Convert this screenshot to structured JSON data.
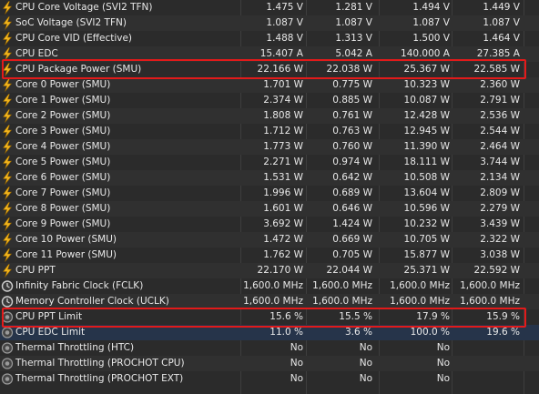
{
  "colors": {
    "background": "#2b2b2b",
    "text": "#e8e8e8",
    "highlight_box": "#e21a1a",
    "selected_row": "#26344a",
    "bolt_icon": "#f2b51d",
    "clock_icon": "#cfcfcf",
    "throttle_icon": "#9a9a9a"
  },
  "rows": [
    {
      "name": "CPU Core Voltage (SVI2 TFN)",
      "icon": "bolt-icon",
      "v1": "1.475 V",
      "v2": "1.281 V",
      "v3": "1.494 V",
      "v4": "1.449 V"
    },
    {
      "name": "SoC Voltage (SVI2 TFN)",
      "icon": "bolt-icon",
      "v1": "1.087 V",
      "v2": "1.087 V",
      "v3": "1.087 V",
      "v4": "1.087 V"
    },
    {
      "name": "CPU Core VID (Effective)",
      "icon": "bolt-icon",
      "v1": "1.488 V",
      "v2": "1.313 V",
      "v3": "1.500 V",
      "v4": "1.464 V"
    },
    {
      "name": "CPU EDC",
      "icon": "bolt-icon",
      "v1": "15.407 A",
      "v2": "5.042 A",
      "v3": "140.000 A",
      "v4": "27.385 A"
    },
    {
      "name": "CPU Package Power (SMU)",
      "icon": "bolt-icon",
      "v1": "22.166 W",
      "v2": "22.038 W",
      "v3": "25.367 W",
      "v4": "22.585 W"
    },
    {
      "name": "Core 0 Power (SMU)",
      "icon": "bolt-icon",
      "v1": "1.701 W",
      "v2": "0.775 W",
      "v3": "10.323 W",
      "v4": "2.360 W"
    },
    {
      "name": "Core 1 Power (SMU)",
      "icon": "bolt-icon",
      "v1": "2.374 W",
      "v2": "0.885 W",
      "v3": "10.087 W",
      "v4": "2.791 W"
    },
    {
      "name": "Core 2 Power (SMU)",
      "icon": "bolt-icon",
      "v1": "1.808 W",
      "v2": "0.761 W",
      "v3": "12.428 W",
      "v4": "2.536 W"
    },
    {
      "name": "Core 3 Power (SMU)",
      "icon": "bolt-icon",
      "v1": "1.712 W",
      "v2": "0.763 W",
      "v3": "12.945 W",
      "v4": "2.544 W"
    },
    {
      "name": "Core 4 Power (SMU)",
      "icon": "bolt-icon",
      "v1": "1.773 W",
      "v2": "0.760 W",
      "v3": "11.390 W",
      "v4": "2.464 W"
    },
    {
      "name": "Core 5 Power (SMU)",
      "icon": "bolt-icon",
      "v1": "2.271 W",
      "v2": "0.974 W",
      "v3": "18.111 W",
      "v4": "3.744 W"
    },
    {
      "name": "Core 6 Power (SMU)",
      "icon": "bolt-icon",
      "v1": "1.531 W",
      "v2": "0.642 W",
      "v3": "10.508 W",
      "v4": "2.134 W"
    },
    {
      "name": "Core 7 Power (SMU)",
      "icon": "bolt-icon",
      "v1": "1.996 W",
      "v2": "0.689 W",
      "v3": "13.604 W",
      "v4": "2.809 W"
    },
    {
      "name": "Core 8 Power (SMU)",
      "icon": "bolt-icon",
      "v1": "1.601 W",
      "v2": "0.646 W",
      "v3": "10.596 W",
      "v4": "2.279 W"
    },
    {
      "name": "Core 9 Power (SMU)",
      "icon": "bolt-icon",
      "v1": "3.692 W",
      "v2": "1.424 W",
      "v3": "10.232 W",
      "v4": "3.439 W"
    },
    {
      "name": "Core 10 Power (SMU)",
      "icon": "bolt-icon",
      "v1": "1.472 W",
      "v2": "0.669 W",
      "v3": "10.705 W",
      "v4": "2.322 W"
    },
    {
      "name": "Core 11 Power (SMU)",
      "icon": "bolt-icon",
      "v1": "1.762 W",
      "v2": "0.705 W",
      "v3": "15.877 W",
      "v4": "3.038 W"
    },
    {
      "name": "CPU PPT",
      "icon": "bolt-icon",
      "v1": "22.170 W",
      "v2": "22.044 W",
      "v3": "25.371 W",
      "v4": "22.592 W"
    },
    {
      "name": "Infinity Fabric Clock (FCLK)",
      "icon": "clock-icon",
      "v1": "1,600.0 MHz",
      "v2": "1,600.0 MHz",
      "v3": "1,600.0 MHz",
      "v4": "1,600.0 MHz"
    },
    {
      "name": "Memory Controller Clock (UCLK)",
      "icon": "clock-icon",
      "v1": "1,600.0 MHz",
      "v2": "1,600.0 MHz",
      "v3": "1,600.0 MHz",
      "v4": "1,600.0 MHz"
    },
    {
      "name": "CPU PPT Limit",
      "icon": "throttle-icon",
      "v1": "15.6 %",
      "v2": "15.5 %",
      "v3": "17.9 %",
      "v4": "15.9 %"
    },
    {
      "name": "CPU EDC Limit",
      "icon": "throttle-icon",
      "v1": "11.0 %",
      "v2": "3.6 %",
      "v3": "100.0 %",
      "v4": "19.6 %"
    },
    {
      "name": "Thermal Throttling (HTC)",
      "icon": "throttle-icon",
      "v1": "No",
      "v2": "No",
      "v3": "No",
      "v4": ""
    },
    {
      "name": "Thermal Throttling (PROCHOT CPU)",
      "icon": "throttle-icon",
      "v1": "No",
      "v2": "No",
      "v3": "No",
      "v4": ""
    },
    {
      "name": "Thermal Throttling (PROCHOT EXT)",
      "icon": "throttle-icon",
      "v1": "No",
      "v2": "No",
      "v3": "No",
      "v4": ""
    }
  ]
}
